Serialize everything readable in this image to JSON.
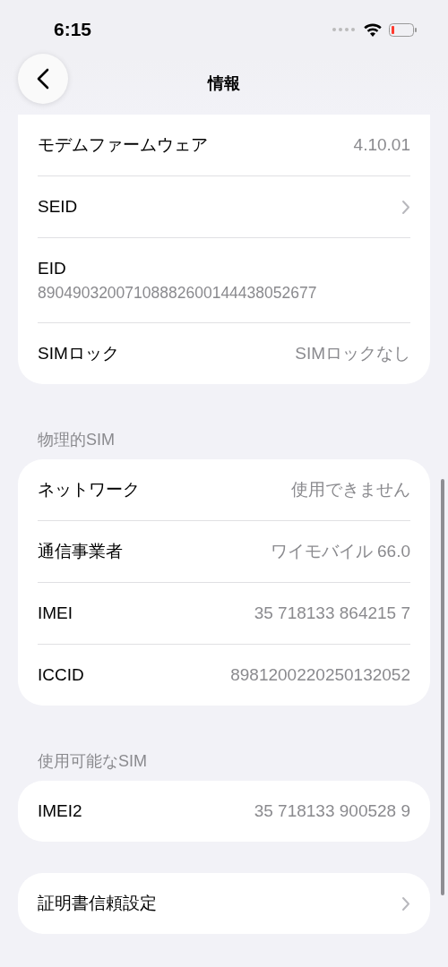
{
  "status_bar": {
    "time": "6:15"
  },
  "nav": {
    "title": "情報"
  },
  "groups": [
    {
      "rows": [
        {
          "kind": "value",
          "label": "モデムファームウェア",
          "value": "4.10.01"
        },
        {
          "kind": "chevron",
          "label": "SEID"
        },
        {
          "kind": "stacked",
          "label": "EID",
          "value": "89049032007108882600144438052677"
        },
        {
          "kind": "value",
          "label": "SIMロック",
          "value": "SIMロックなし"
        }
      ]
    },
    {
      "header": "物理的SIM",
      "rows": [
        {
          "kind": "value",
          "label": "ネットワーク",
          "value": "使用できません"
        },
        {
          "kind": "value",
          "label": "通信事業者",
          "value": "ワイモバイル 66.0"
        },
        {
          "kind": "value",
          "label": "IMEI",
          "value": "35 718133 864215 7"
        },
        {
          "kind": "value",
          "label": "ICCID",
          "value": "8981200220250132052"
        }
      ]
    },
    {
      "header": "使用可能なSIM",
      "rows": [
        {
          "kind": "value",
          "label": "IMEI2",
          "value": "35 718133 900528 9"
        }
      ]
    },
    {
      "rows": [
        {
          "kind": "chevron",
          "label": "証明書信頼設定"
        }
      ]
    }
  ]
}
